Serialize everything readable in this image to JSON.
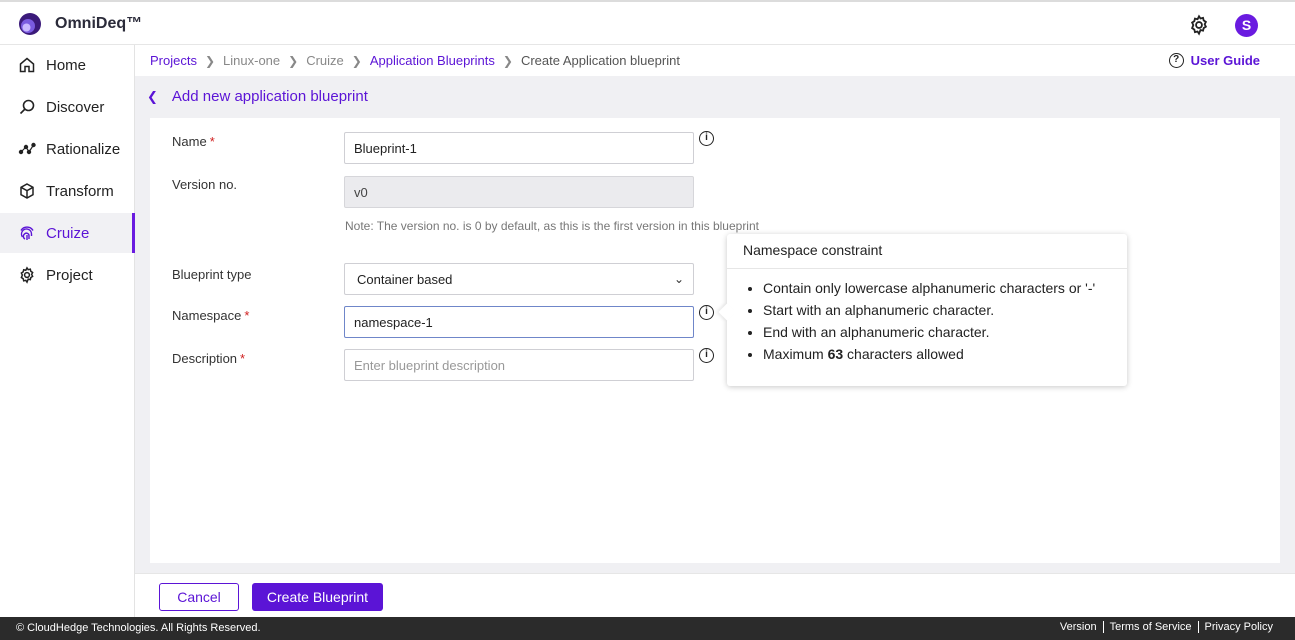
{
  "header": {
    "brand": "OmniDeq™",
    "avatar_initial": "S"
  },
  "sidebar": {
    "items": [
      {
        "label": "Home",
        "icon": "home-icon"
      },
      {
        "label": "Discover",
        "icon": "discover-icon"
      },
      {
        "label": "Rationalize",
        "icon": "rationalize-icon"
      },
      {
        "label": "Transform",
        "icon": "cube-icon"
      },
      {
        "label": "Cruize",
        "icon": "fingerprint-icon",
        "active": true
      },
      {
        "label": "Project",
        "icon": "gear-icon"
      }
    ]
  },
  "breadcrumb": {
    "items": [
      "Projects",
      "Linux-one",
      "Cruize",
      "Application Blueprints",
      "Create Application blueprint"
    ],
    "user_guide": "User Guide"
  },
  "page": {
    "title": "Add new application blueprint"
  },
  "form": {
    "name": {
      "label": "Name",
      "value": "Blueprint-1"
    },
    "version": {
      "label": "Version no.",
      "value": "v0",
      "note": "Note: The version no. is 0 by default, as this is the first version in this blueprint"
    },
    "blueprint_type": {
      "label": "Blueprint type",
      "value": "Container based"
    },
    "namespace": {
      "label": "Namespace",
      "value": "namespace-1"
    },
    "description": {
      "label": "Description",
      "placeholder": "Enter blueprint description"
    },
    "required_mark": "*"
  },
  "tooltip": {
    "title": "Namespace constraint",
    "items": [
      "Contain only lowercase alphanumeric characters or '-'",
      "Start with an alphanumeric character.",
      "End with an alphanumeric character."
    ],
    "max_prefix": "Maximum ",
    "max_value": "63",
    "max_suffix": " characters allowed"
  },
  "buttons": {
    "cancel": "Cancel",
    "create": "Create Blueprint"
  },
  "footer": {
    "copyright": "© CloudHedge Technologies. All Rights Reserved.",
    "links": [
      "Version",
      "Terms of Service",
      "Privacy Policy"
    ]
  },
  "colors": {
    "accent": "#5b14d6",
    "required": "#d01e1e",
    "footer_bg": "#2b2b2b"
  }
}
